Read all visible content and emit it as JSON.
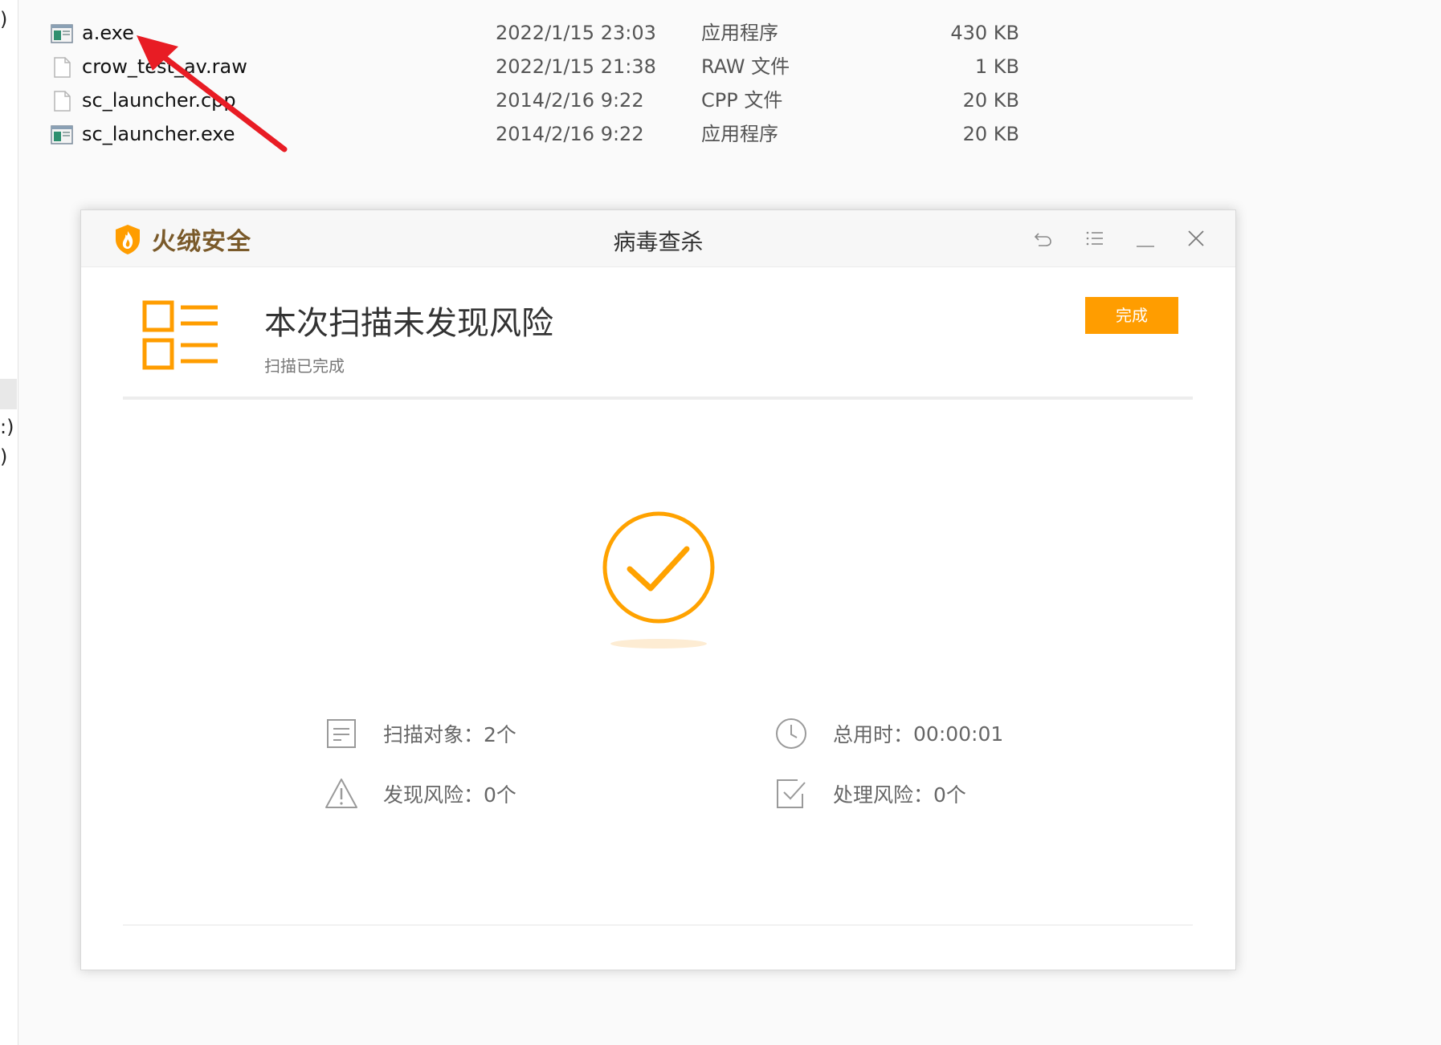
{
  "nav": {
    "frag1": ")",
    "frag2": ":)",
    "frag3": ")"
  },
  "files": [
    {
      "name": "a.exe",
      "date": "2022/1/15 23:03",
      "type": "应用程序",
      "size": "430 KB",
      "icon": "exe-icon"
    },
    {
      "name": "crow_test_av.raw",
      "date": "2022/1/15 21:38",
      "type": "RAW 文件",
      "size": "1 KB",
      "icon": "file-icon"
    },
    {
      "name": "sc_launcher.cpp",
      "date": "2014/2/16 9:22",
      "type": "CPP 文件",
      "size": "20 KB",
      "icon": "file-icon"
    },
    {
      "name": "sc_launcher.exe",
      "date": "2014/2/16 9:22",
      "type": "应用程序",
      "size": "20 KB",
      "icon": "exe-icon"
    }
  ],
  "dialog": {
    "brand": "火绒安全",
    "title": "病毒查杀",
    "headline": "本次扫描未发现风险",
    "subline": "扫描已完成",
    "done_label": "完成",
    "stats": {
      "scan_targets": {
        "label": "扫描对象：",
        "value": "2个"
      },
      "total_time": {
        "label": "总用时：",
        "value": "00:00:01"
      },
      "risks_found": {
        "label": "发现风险：",
        "value": "0个"
      },
      "risks_handled": {
        "label": "处理风险：",
        "value": "0个"
      }
    }
  },
  "colors": {
    "accent": "#ff9d00",
    "arrow": "#e81c24",
    "brand_text": "#7a5a2a"
  }
}
